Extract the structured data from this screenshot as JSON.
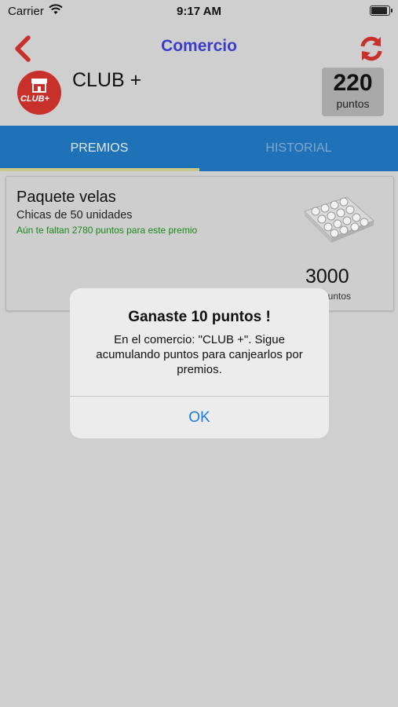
{
  "status_bar": {
    "carrier": "Carrier",
    "time": "9:17 AM",
    "battery_level": 1.0
  },
  "nav": {
    "title": "Comercio",
    "back_icon": "chevron-left-icon",
    "refresh_icon": "refresh-icon"
  },
  "merchant": {
    "name": "CLUB +",
    "logo_text": "CLUB+",
    "points_value": "220",
    "points_label": "puntos"
  },
  "tabs": [
    {
      "label": "PREMIOS",
      "active": true
    },
    {
      "label": "HISTORIAL",
      "active": false
    }
  ],
  "prize": {
    "title": "Paquete velas",
    "subtitle": "Chicas de 50 unidades",
    "note": "Aún te faltan 2780 puntos para este premio",
    "points_value": "3000",
    "points_label": "puntos"
  },
  "dialog": {
    "title": "Ganaste 10 puntos !",
    "message": "En el comercio: \"CLUB +\". Sigue acumulando puntos para canjearlos por premios.",
    "ok_label": "OK"
  },
  "colors": {
    "accent_red": "#c8302b",
    "title_blue": "#3c3cc8",
    "tab_blue": "#1f72b8",
    "ok_blue": "#1a7be0",
    "note_green": "#1a8a1a"
  }
}
